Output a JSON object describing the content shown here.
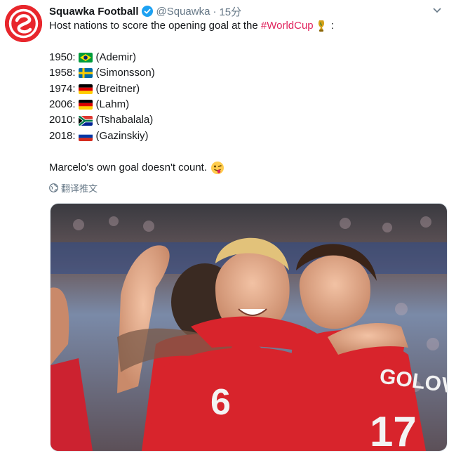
{
  "account": {
    "name": "Squawka Football",
    "handle": "@Squawka",
    "separator": "·",
    "time": "15分",
    "avatar_color": "#e8262c",
    "verified_icon": "verified-badge-icon"
  },
  "tweet": {
    "intro_prefix": "Host nations to score the opening goal at the ",
    "hashtag": "#WorldCup",
    "intro_suffix": " :",
    "entries": [
      {
        "year": "1950:",
        "flag": "brazil",
        "scorer": "(Ademir)"
      },
      {
        "year": "1958:",
        "flag": "sweden",
        "scorer": "(Simonsson)"
      },
      {
        "year": "1974:",
        "flag": "germany",
        "scorer": "(Breitner)"
      },
      {
        "year": "2006:",
        "flag": "germany",
        "scorer": "(Lahm)"
      },
      {
        "year": "2010:",
        "flag": "south-africa",
        "scorer": "(Tshabalala)"
      },
      {
        "year": "2018:",
        "flag": "russia",
        "scorer": "(Gazinskiy)"
      }
    ],
    "closing": "Marcelo's own goal doesn't count.",
    "closing_emoji": "winking-face-tongue-icon"
  },
  "translate": {
    "label": "翻译推文",
    "icon": "globe-icon"
  },
  "photo": {
    "description_icon": "football-celebration-photo",
    "jersey_text": "GOLOV",
    "jersey_numbers": [
      "6",
      "17"
    ]
  },
  "colors": {
    "hashtag": "#e0245e",
    "muted": "#657786",
    "verified": "#1da1f2",
    "jersey_red": "#d8242c"
  }
}
